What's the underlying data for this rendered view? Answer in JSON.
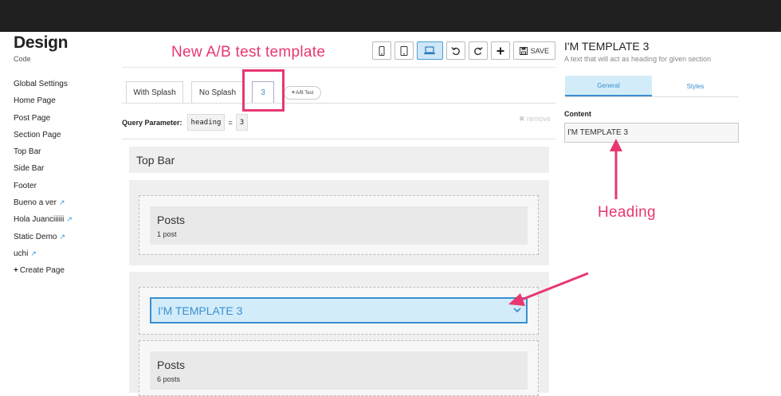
{
  "sidebar": {
    "title": "Design",
    "subtitle": "Code",
    "items": [
      {
        "label": "Global Settings"
      },
      {
        "label": "Home Page"
      },
      {
        "label": "Post Page"
      },
      {
        "label": "Section Page"
      },
      {
        "label": "Top Bar"
      },
      {
        "label": "Side Bar"
      },
      {
        "label": "Footer"
      },
      {
        "label": "Bueno a ver"
      },
      {
        "label": "Hola Juanciiiiii"
      },
      {
        "label": "Static Demo"
      },
      {
        "label": "uchi"
      }
    ],
    "create_page": "Create Page"
  },
  "toolbar": {
    "save_label": "SAVE",
    "icons": [
      "phone-icon",
      "tablet-icon",
      "laptop-icon",
      "undo-icon",
      "redo-icon",
      "plus-icon",
      "floppy-disk-icon"
    ]
  },
  "annotations": {
    "top": "New A/B test template",
    "right": "Heading",
    "color": "#e8376f"
  },
  "tabs": [
    {
      "label": "With Splash"
    },
    {
      "label": "No Splash"
    },
    {
      "label": "3",
      "active": true
    }
  ],
  "ab_test_label": "A/B Test",
  "query": {
    "label": "Query Parameter:",
    "key": "heading",
    "equals": "=",
    "value": "3",
    "remove": "remove"
  },
  "sections": {
    "top_bar": "Top Bar",
    "posts1_title": "Posts",
    "posts1_count": "1 post",
    "template_label": "I'M TEMPLATE 3",
    "posts2_title": "Posts",
    "posts2_count": "6 posts"
  },
  "panel": {
    "title": "I'M TEMPLATE 3",
    "subtitle": "A text that will act as heading for given section",
    "tabs": [
      "General",
      "Styles"
    ],
    "content_label": "Content",
    "content_value": "I'M TEMPLATE 3"
  },
  "colors": {
    "accent": "#3a8fd0",
    "annotation": "#e8376f",
    "topbar": "#202020"
  }
}
